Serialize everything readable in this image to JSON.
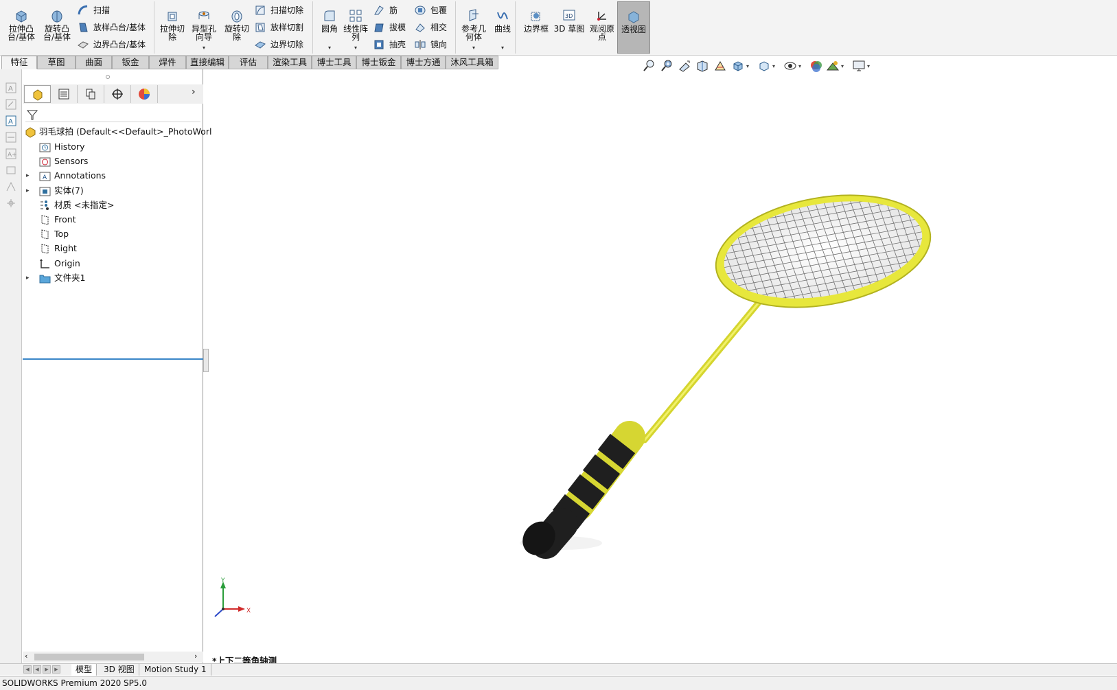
{
  "ribbon": {
    "features": {
      "extrude_boss": "拉伸凸台/基体",
      "revolve_boss": "旋转凸台/基体",
      "sweep": "扫描",
      "loft_boss": "放样凸台/基体",
      "boundary_boss": "边界凸台/基体",
      "extrude_cut": "拉伸切除",
      "hole_wizard": "异型孔向导",
      "revolve_cut": "旋转切除",
      "swept_cut": "扫描切除",
      "lofted_cut": "放样切割",
      "boundary_cut": "边界切除",
      "fillet": "圆角",
      "linear_pattern": "线性阵列",
      "rib": "筋",
      "draft": "拔模",
      "shell": "抽壳",
      "wrap": "包覆",
      "intersect": "相交",
      "mirror": "镜向",
      "ref_geometry": "参考几何体",
      "curves": "曲线",
      "bounding_box": "边界框",
      "sketch_3d": "3D 草图",
      "view_origin": "观阅原点",
      "see_through": "透视图"
    },
    "tabs": [
      "特征",
      "草图",
      "曲面",
      "钣金",
      "焊件",
      "直接编辑",
      "评估",
      "渲染工具",
      "博士工具",
      "博士钣金",
      "博士方通",
      "沐风工具箱"
    ],
    "active_tab": "特征"
  },
  "feature_manager": {
    "root_label": "羽毛球拍",
    "root_config": "(Default<<Default>_PhotoWorl",
    "items": [
      {
        "label": "History",
        "icon": "history-folder-icon",
        "expandable": false
      },
      {
        "label": "Sensors",
        "icon": "sensors-folder-icon",
        "expandable": false
      },
      {
        "label": "Annotations",
        "icon": "annotations-folder-icon",
        "expandable": true
      },
      {
        "label": "实体(7)",
        "icon": "solid-bodies-folder-icon",
        "expandable": true
      },
      {
        "label": "材质 <未指定>",
        "icon": "material-icon",
        "expandable": false
      },
      {
        "label": "Front",
        "icon": "plane-icon",
        "expandable": false
      },
      {
        "label": "Top",
        "icon": "plane-icon",
        "expandable": false
      },
      {
        "label": "Right",
        "icon": "plane-icon",
        "expandable": false
      },
      {
        "label": "Origin",
        "icon": "origin-icon",
        "expandable": false
      },
      {
        "label": "文件夹1",
        "icon": "folder-icon",
        "expandable": true
      }
    ]
  },
  "viewport": {
    "view_orientation": "*上下二等角轴测",
    "triad": {
      "x": "X",
      "y": "Y"
    }
  },
  "bottom_tabs": [
    "模型",
    "3D 视图",
    "Motion Study 1"
  ],
  "active_bottom_tab": "模型",
  "status_bar": "SOLIDWORKS Premium 2020 SP5.0",
  "colors": {
    "racket_frame": "#e6e63a",
    "grip_black": "#1c1c1c",
    "grip_yellow": "#d9d930",
    "strings": "#5a5a5a",
    "tree_separator": "#3a86c8",
    "active_button": "#b6b6b6"
  }
}
